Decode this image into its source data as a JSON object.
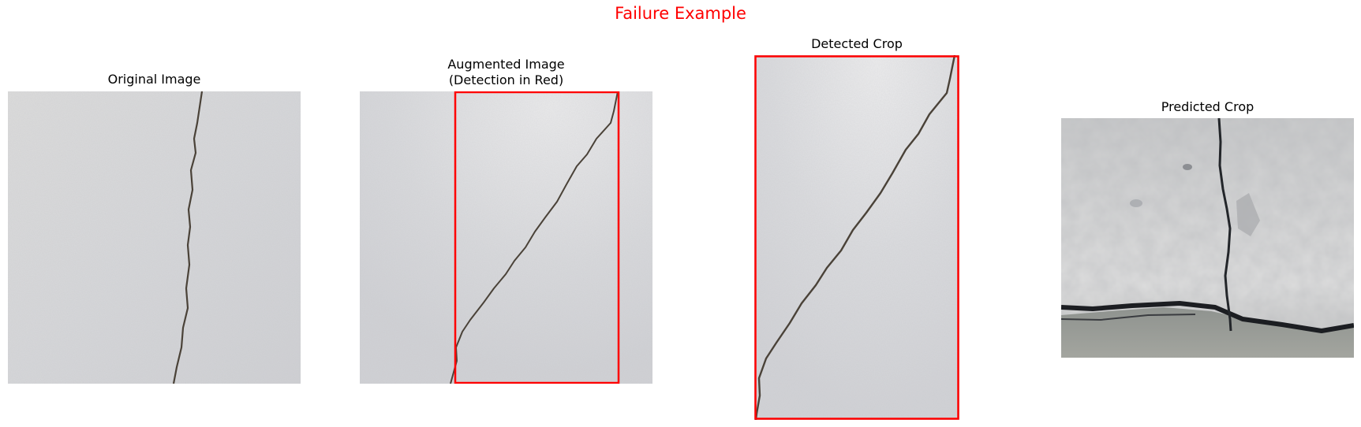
{
  "figure": {
    "title": "Failure Example",
    "title_color": "#ff0000",
    "detection_color": "#ff0000"
  },
  "panels": [
    {
      "title_line1": "Original Image",
      "title_line2": ""
    },
    {
      "title_line1": "Augmented Image",
      "title_line2": "(Detection in Red)"
    },
    {
      "title_line1": "Detected Crop",
      "title_line2": ""
    },
    {
      "title_line1": "Predicted Crop",
      "title_line2": ""
    }
  ]
}
